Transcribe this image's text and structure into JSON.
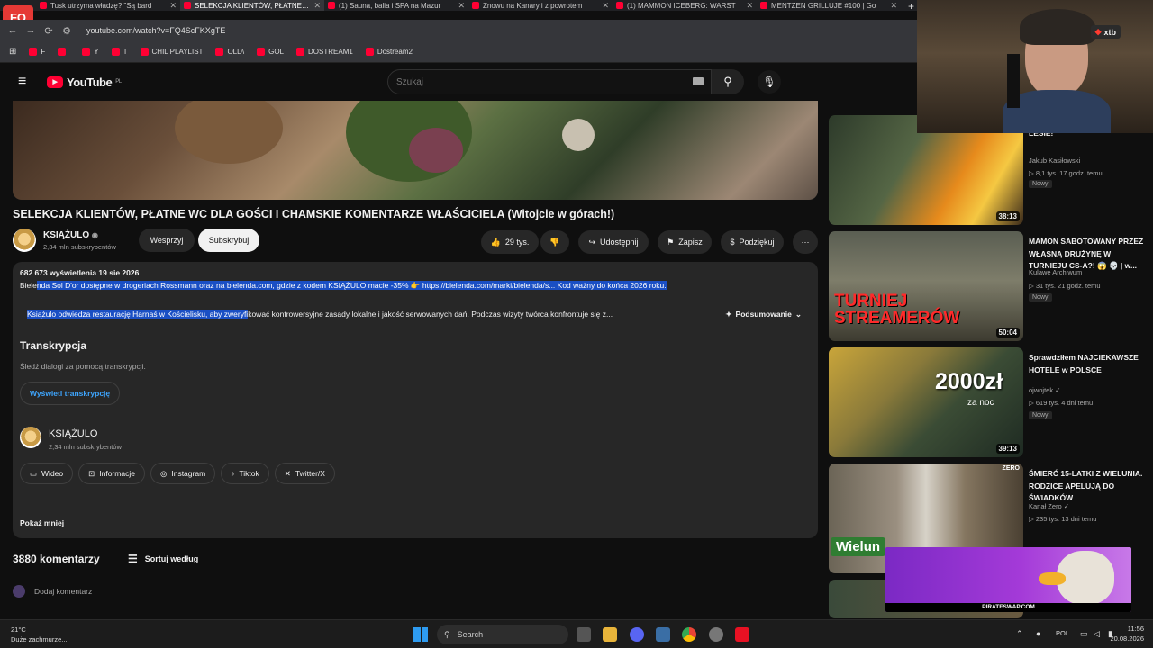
{
  "browser": {
    "tabs": [
      {
        "label": "Tusk utrzyma władzę? \"Są bard",
        "active": false
      },
      {
        "label": "SELEKCJA KLIENTÓW, PŁATNE W",
        "active": true
      },
      {
        "label": "(1) Sauna, balia i SPA na Mazur",
        "active": false
      },
      {
        "label": "Znowu na Kanary i z powrotem",
        "active": false
      },
      {
        "label": "(1) MAMMON ICEBERG: WARST",
        "active": false
      },
      {
        "label": "MENTZEN GRILLUJE #100 | Go",
        "active": false
      }
    ],
    "new_tab": "+",
    "url": "youtube.com/watch?v=FQ4ScFKXgTE",
    "bookmarks": [
      "F",
      "",
      "Y",
      "T",
      "CHIL PLAYLIST",
      "OLD\\",
      "GOL",
      "DOSTREAM1",
      "Dostream2"
    ]
  },
  "badge_text": "FO",
  "youtube": {
    "logo": "YouTube",
    "region": "PL",
    "search_placeholder": "Szukaj"
  },
  "video": {
    "title": "SELEKCJA KLIENTÓW, PŁATNE WC DLA GOŚCI I CHAMSKIE KOMENTARZE WŁAŚCICIELA (Witojcie w górach!)",
    "channel": "KSIĄŻULO",
    "subscribers": "2,34 mln subskrybentów",
    "support_label": "Wesprzyj",
    "subscribe_label": "Subskrybuj",
    "likes": "29 tys.",
    "share_label": "Udostępnij",
    "save_label": "Zapisz",
    "thanks_label": "Podziękuj",
    "more_label": "⋯"
  },
  "description": {
    "views_date": "682 673 wyświetlenia  19 sie 2026",
    "promo_plain": "Biele",
    "promo_highlight": "nda Sol D'or dostępne w drogeriach Rossmann oraz na bielenda.com, gdzie z kodem KSIĄŻULO macie -35% 👉 https://bielenda.com/marki/bielenda/s...  Kod ważny do końca 2026 roku.",
    "summary_highlight": "Książulo odwiedza restaurację Harnaś w Kościelisku, aby zweryfi",
    "summary_rest": "kować kontrowersyjne zasady lokalne i jakość serwowanych dań. Podczas wizyty twórca konfrontuje się z...",
    "summary_button": "Podsumowanie",
    "transcript_title": "Transkrypcja",
    "transcript_sub": "Śledź dialogi za pomocą transkrypcji.",
    "transcript_button": "Wyświetl transkrypcję",
    "channel_name": "KSIĄŻULO",
    "channel_subs": "2,34 mln subskrybentów",
    "links": [
      "Wideo",
      "Informacje",
      "Instagram",
      "Tiktok",
      "Twitter/X"
    ],
    "show_less": "Pokaż mniej"
  },
  "comments": {
    "count_label": "3880 komentarzy",
    "sort_label": "Sortuj według",
    "add_placeholder": "Dodaj komentarz"
  },
  "sidebar": [
    {
      "title_fragment": "LESIE!",
      "channel": "Jakub Kasiłowski",
      "meta": "▷ 8,1 tys.   17 godz. temu",
      "badge": "Nowy",
      "duration": "38:13"
    },
    {
      "title": "MAMON SABOTOWANY PRZEZ WŁASNĄ DRUŻYNĘ W TURNIEJU CS-A?! 😱 💀 | w...",
      "channel": "Kulawe Archiwum",
      "meta": "▷ 31 tys.   21 godz. temu",
      "badge": "Nowy",
      "duration": "50:04",
      "thumb_text": "TURNIEJ STREAMERÓW"
    },
    {
      "title": "Sprawdziłem NAJCIEKAWSZE HOTELE w POLSCE",
      "channel": "ojwojtek ✓",
      "meta": "▷ 619 tys.   4 dni temu",
      "badge": "Nowy",
      "duration": "39:13",
      "thumb_text": "2000zł",
      "thumb_sub": "za noc"
    },
    {
      "title": "ŚMIERĆ 15-LATKI Z WIELUNIA. RODZICE APELUJĄ DO ŚWIADKÓW",
      "channel": "Kanał Zero ✓",
      "meta": "▷ 235 tys.   13 dni temu",
      "thumb_text": "Wielun",
      "thumb_brand": "ZERO"
    }
  ],
  "stream": {
    "sponsor": "xtb",
    "ad_brand": "PIRATESWAP.COM"
  },
  "taskbar": {
    "temp": "21°C",
    "weather": "Duże zachmurze...",
    "search": "Search",
    "lang": "POL",
    "time": "11:56",
    "date": "20.08.2026"
  },
  "colors": {
    "accent": "#ff0033",
    "link": "#3ea6ff",
    "highlight": "#1a4fc4"
  }
}
